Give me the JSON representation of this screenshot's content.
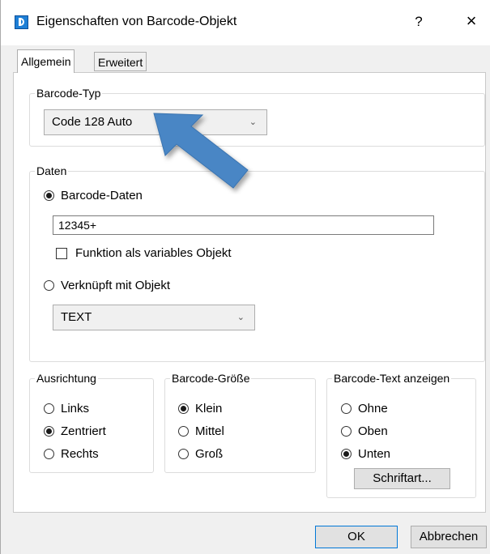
{
  "window": {
    "title": "Eigenschaften von Barcode-Objekt",
    "help": "?",
    "close": "×"
  },
  "tabs": [
    "Allgemein",
    "Erweitert"
  ],
  "barcode_type": {
    "legend": "Barcode-Typ",
    "selected": "Code 128 Auto",
    "arrow": "⌄"
  },
  "daten": {
    "legend": "Daten",
    "option_data": "Barcode-Daten",
    "data_value": "12345+",
    "checkbox_label": "Funktion als variables Objekt",
    "option_linked": "Verknüpft mit Objekt",
    "linked_selected": "TEXT",
    "arrow": "⌄"
  },
  "ausrichtung": {
    "legend": "Ausrichtung",
    "options": [
      "Links",
      "Zentriert",
      "Rechts"
    ],
    "selected": "Zentriert"
  },
  "groesse": {
    "legend": "Barcode-Größe",
    "options": [
      "Klein",
      "Mittel",
      "Groß"
    ],
    "selected": "Klein"
  },
  "text_anzeigen": {
    "legend": "Barcode-Text anzeigen",
    "options": [
      "Ohne",
      "Oben",
      "Unten"
    ],
    "selected": "Unten",
    "font_button": "Schriftart..."
  },
  "footer": {
    "ok": "OK",
    "cancel": "Abbrechen"
  },
  "colors": {
    "accent": "#0078d7",
    "arrow_fill": "#4a86c5"
  }
}
